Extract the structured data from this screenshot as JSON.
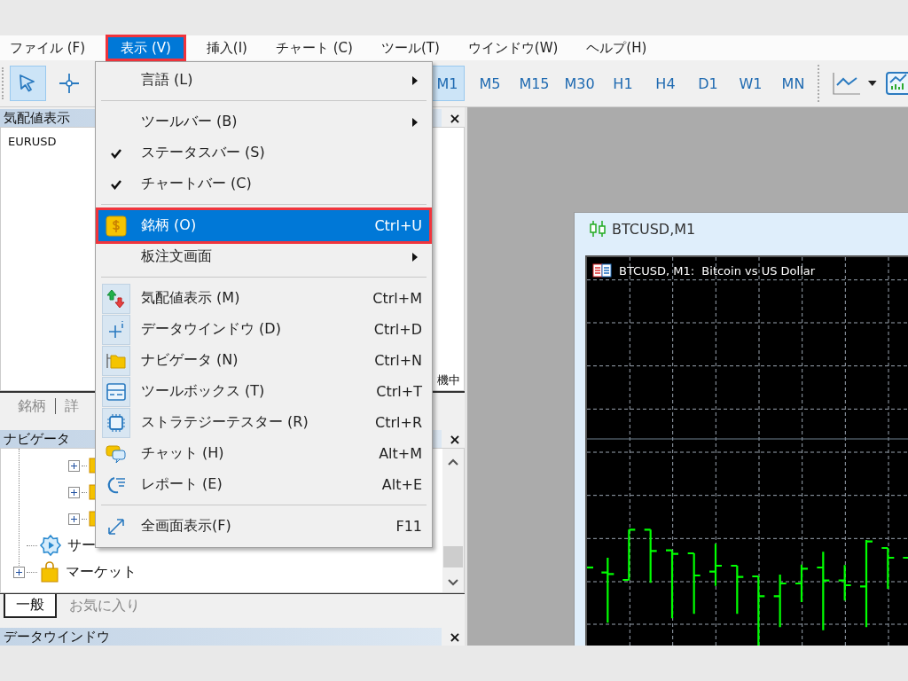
{
  "menu_bar": [
    {
      "label": "ファイル (F)",
      "selected": false,
      "callout": false
    },
    {
      "label": "表示 (V)",
      "selected": true,
      "callout": true
    },
    {
      "label": "挿入(I)",
      "selected": false,
      "callout": false
    },
    {
      "label": "チャート (C)",
      "selected": false,
      "callout": false
    },
    {
      "label": "ツール(T)",
      "selected": false,
      "callout": false
    },
    {
      "label": "ウインドウ(W)",
      "selected": false,
      "callout": false
    },
    {
      "label": "ヘルプ(H)",
      "selected": false,
      "callout": false
    }
  ],
  "toolbar": {
    "tools": [
      {
        "selected": true
      },
      {
        "selected": false
      }
    ],
    "timeframes": [
      {
        "label": "M1",
        "selected": true
      },
      {
        "label": "M5",
        "selected": false
      },
      {
        "label": "M15",
        "selected": false
      },
      {
        "label": "M30",
        "selected": false
      },
      {
        "label": "H1",
        "selected": false
      },
      {
        "label": "H4",
        "selected": false
      },
      {
        "label": "D1",
        "selected": false
      },
      {
        "label": "W1",
        "selected": false
      },
      {
        "label": "MN",
        "selected": false
      }
    ]
  },
  "market_watch": {
    "title": "気配値表示",
    "close": "×",
    "symbols": [
      "EURUSD"
    ],
    "status": "機中",
    "tabs": [
      {
        "label": "銘柄",
        "selected": false
      },
      {
        "label": "詳",
        "selected": false
      }
    ]
  },
  "navigator": {
    "title": "ナビゲータ",
    "close": "×",
    "tree": [
      {
        "children": [
          {
            "expanded": false
          },
          {
            "expanded": false
          },
          {
            "expanded": false
          }
        ]
      },
      {
        "label": "サー"
      },
      {
        "label": "マーケット",
        "expanded": false
      }
    ],
    "tabs": [
      {
        "label": "一般",
        "selected": true
      },
      {
        "label": "お気に入り",
        "selected": false
      }
    ]
  },
  "data_window": {
    "title": "データウインドウ",
    "close": "×"
  },
  "chart_window": {
    "title": "BTCUSD,M1",
    "chart_label": "BTCUSD, M1:  Bitcoin vs US Dollar"
  },
  "view_menu": [
    {
      "kind": "item",
      "label": "言語 (L)",
      "checked": false,
      "submenu": true,
      "selected": false,
      "callout": false
    },
    {
      "kind": "separator"
    },
    {
      "kind": "item",
      "label": "ツールバー (B)",
      "checked": false,
      "submenu": true,
      "selected": false,
      "callout": false
    },
    {
      "kind": "item",
      "label": "ステータスバー (S)",
      "checked": true,
      "submenu": false,
      "selected": false,
      "callout": false
    },
    {
      "kind": "item",
      "label": "チャートバー (C)",
      "checked": true,
      "submenu": false,
      "selected": false,
      "callout": false
    },
    {
      "kind": "separator"
    },
    {
      "kind": "item",
      "label": "銘柄 (O)",
      "shortcut": "Ctrl+U",
      "checked": false,
      "submenu": false,
      "selected": true,
      "callout": true
    },
    {
      "kind": "item",
      "label": "板注文画面",
      "checked": false,
      "submenu": true,
      "selected": false,
      "callout": false
    },
    {
      "kind": "separator"
    },
    {
      "kind": "item",
      "label": "気配値表示 (M)",
      "shortcut": "Ctrl+M",
      "checked": true,
      "submenu": false,
      "selected": false,
      "callout": false
    },
    {
      "kind": "item",
      "label": "データウインドウ (D)",
      "shortcut": "Ctrl+D",
      "checked": true,
      "submenu": false,
      "selected": false,
      "callout": false
    },
    {
      "kind": "item",
      "label": "ナビゲータ (N)",
      "shortcut": "Ctrl+N",
      "checked": true,
      "submenu": false,
      "selected": false,
      "callout": false
    },
    {
      "kind": "item",
      "label": "ツールボックス (T)",
      "shortcut": "Ctrl+T",
      "checked": true,
      "submenu": false,
      "selected": false,
      "callout": false
    },
    {
      "kind": "item",
      "label": "ストラテジーテスター (R)",
      "shortcut": "Ctrl+R",
      "checked": true,
      "submenu": false,
      "selected": false,
      "callout": false
    },
    {
      "kind": "item",
      "label": "チャット (H)",
      "shortcut": "Alt+M",
      "checked": false,
      "submenu": false,
      "selected": false,
      "callout": false
    },
    {
      "kind": "item",
      "label": "レポート (E)",
      "shortcut": "Alt+E",
      "checked": false,
      "submenu": false,
      "selected": false,
      "callout": false
    },
    {
      "kind": "separator"
    },
    {
      "kind": "item",
      "label": "全画面表示(F)",
      "shortcut": "F11",
      "checked": false,
      "submenu": false,
      "selected": false,
      "callout": false
    }
  ]
}
